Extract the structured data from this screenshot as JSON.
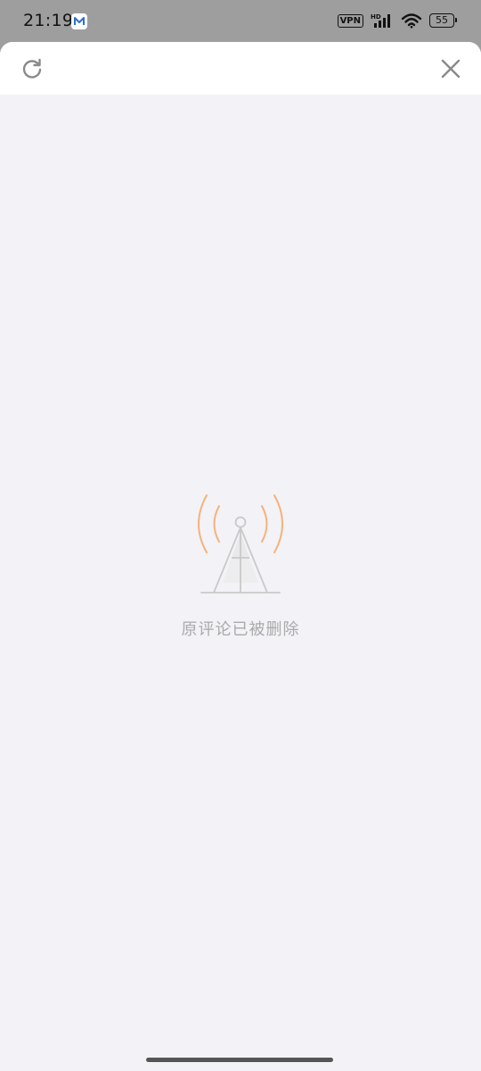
{
  "status_bar": {
    "time": "21:19",
    "vpn_label": "VPN",
    "hd_label": "HD",
    "battery_level": "55",
    "icons": [
      "mail-app-icon",
      "vpn-icon",
      "signal-icon",
      "wifi-icon",
      "battery-icon"
    ]
  },
  "header": {
    "refresh_icon": "refresh-icon",
    "close_icon": "close-icon"
  },
  "empty_state": {
    "icon": "signal-tower-icon",
    "message": "原评论已被删除"
  },
  "colors": {
    "status_bar_bg": "#9e9e9e",
    "sheet_bg": "#f3f2f7",
    "header_bg": "#ffffff",
    "accent_orange": "#f5b27a",
    "muted_text": "#aaaaaa"
  }
}
